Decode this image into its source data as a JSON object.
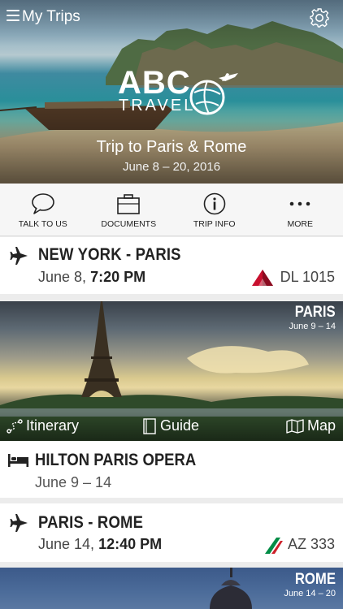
{
  "header": {
    "title": "My Trips",
    "menu_icon": "hamburger-menu-icon",
    "settings_icon": "gear-icon"
  },
  "hero": {
    "brand_main": "ABC",
    "brand_sub": "TRAVEL",
    "trip_title": "Trip to Paris & Rome",
    "trip_dates": "June 8 – 20, 2016"
  },
  "actions": [
    {
      "label": "TALK TO US",
      "icon": "chat-bubble-icon"
    },
    {
      "label": "DOCUMENTS",
      "icon": "briefcase-icon"
    },
    {
      "label": "TRIP INFO",
      "icon": "info-icon"
    },
    {
      "label": "MORE",
      "icon": "more-dots-icon"
    }
  ],
  "flights": [
    {
      "route": "NEW YORK - PARIS",
      "date": "June 8,",
      "time": "7:20 PM",
      "flight_number": "DL 1015",
      "airline_icon": "delta-logo-icon"
    },
    {
      "route": "PARIS - ROME",
      "date": "June 14,",
      "time": "12:40 PM",
      "flight_number": "AZ 333",
      "airline_icon": "alitalia-logo-icon"
    }
  ],
  "cities": [
    {
      "name": "PARIS",
      "range": "June 9 – 14",
      "links": [
        "Itinerary",
        "Guide",
        "Map"
      ]
    },
    {
      "name": "ROME",
      "range": "June 14 – 20"
    }
  ],
  "hotel": {
    "name": "HILTON PARIS OPERA",
    "dates": "June 9 – 14"
  },
  "colors": {
    "delta_red": "#c8102e",
    "alitalia_green": "#008c45",
    "alitalia_red": "#cd212a",
    "card_bg": "#ffffff",
    "page_bg": "#ececec"
  }
}
